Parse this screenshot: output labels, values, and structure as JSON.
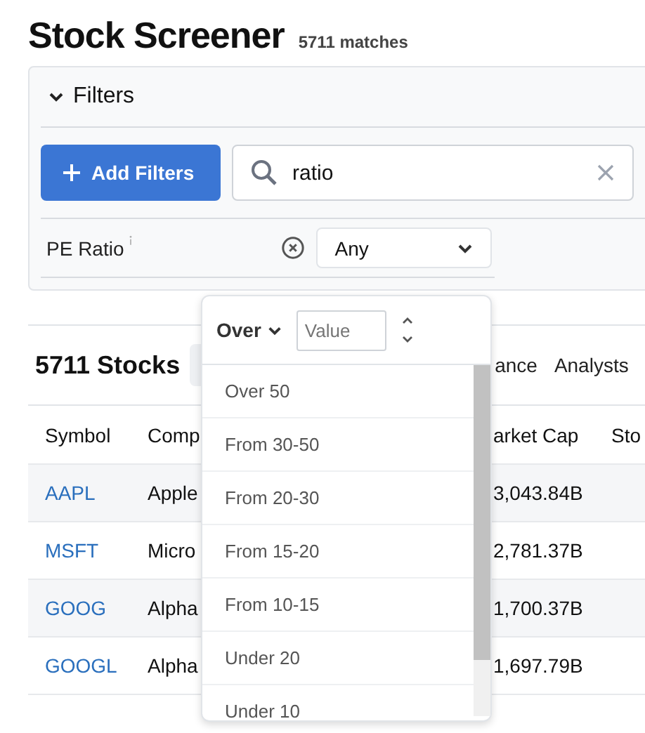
{
  "title": "Stock Screener",
  "match_count": "5711 matches",
  "filters": {
    "title": "Filters",
    "expanded": true,
    "add_button": "Add Filters",
    "search": {
      "value": "ratio"
    },
    "items": [
      {
        "label": "PE Ratio",
        "value": "Any"
      }
    ]
  },
  "results": {
    "title": "5711 Stocks",
    "tabs": [
      {
        "label": "ance"
      },
      {
        "label": "Analysts"
      }
    ],
    "columns": [
      "Symbol",
      "Comp",
      "arket Cap",
      "Sto"
    ],
    "rows": [
      {
        "symbol": "AAPL",
        "company": "Apple",
        "market_cap": "3,043.84B"
      },
      {
        "symbol": "MSFT",
        "company": "Micro",
        "market_cap": "2,781.37B"
      },
      {
        "symbol": "GOOG",
        "company": "Alpha",
        "market_cap": "1,700.37B"
      },
      {
        "symbol": "GOOGL",
        "company": "Alpha",
        "market_cap": "1,697.79B"
      }
    ]
  },
  "dropdown": {
    "operator": "Over",
    "value_placeholder": "Value",
    "options": [
      "Over 50",
      "From 30-50",
      "From 20-30",
      "From 15-20",
      "From 10-15",
      "Under 20",
      "Under 10"
    ]
  }
}
